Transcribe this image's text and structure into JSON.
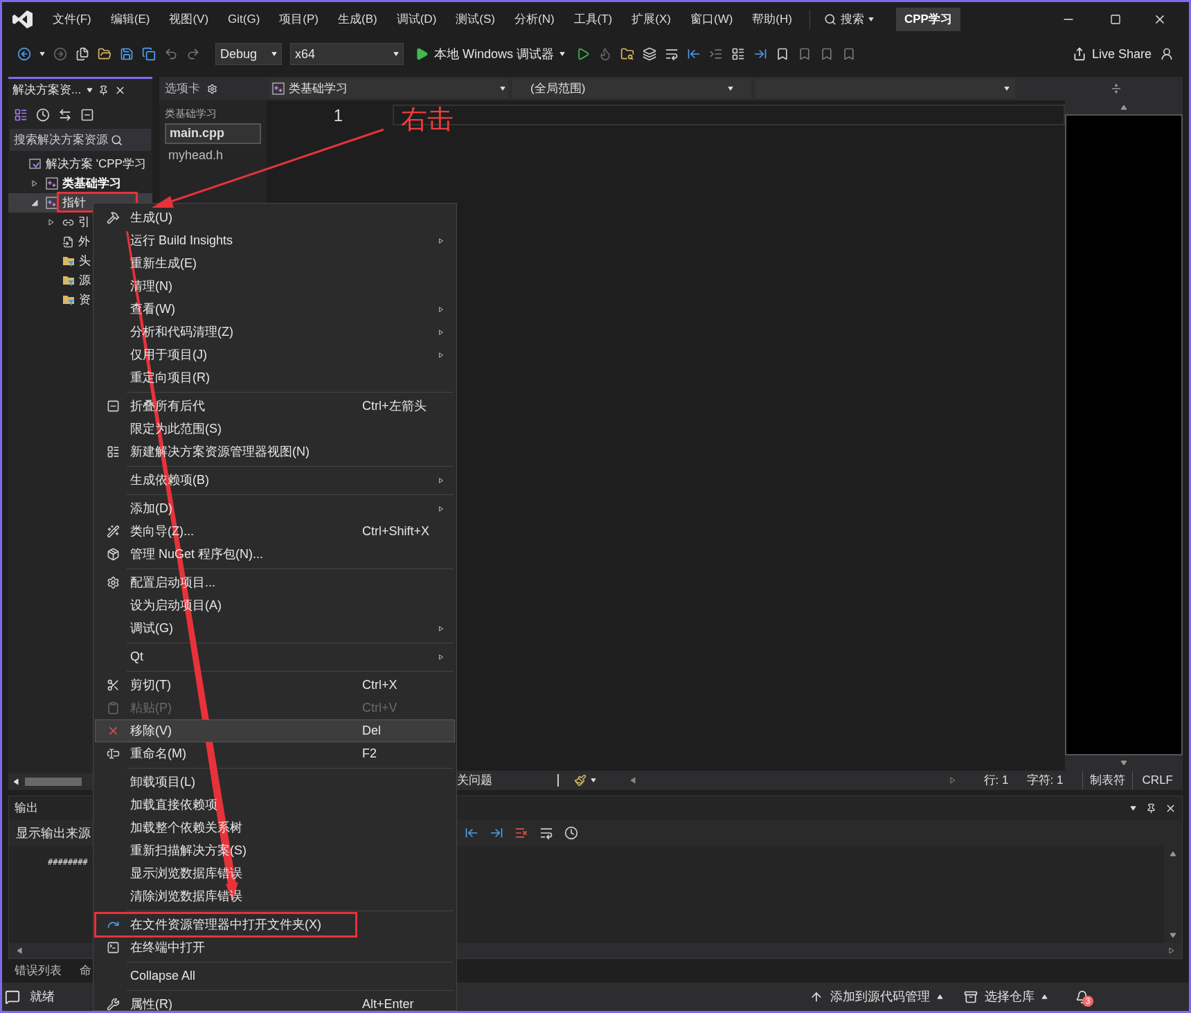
{
  "menubar": {
    "items": [
      "文件(F)",
      "编辑(E)",
      "视图(V)",
      "Git(G)",
      "项目(P)",
      "生成(B)",
      "调试(D)",
      "测试(S)",
      "分析(N)",
      "工具(T)",
      "扩展(X)",
      "窗口(W)",
      "帮助(H)"
    ],
    "search": "搜索",
    "solution_name": "CPP学习"
  },
  "toolbar": {
    "configuration": "Debug",
    "platform": "x64",
    "debugger": "本地 Windows 调试器",
    "live_share": "Live Share"
  },
  "solution_explorer": {
    "title": "解决方案资...",
    "search_placeholder": "搜索解决方案资源",
    "tree": [
      {
        "label": "解决方案 'CPP学习",
        "kind": "solution",
        "children": [
          {
            "label": "类基础学习",
            "kind": "project",
            "startup": true,
            "expanded": false,
            "selected": false,
            "annotated": false
          },
          {
            "label": "指针",
            "kind": "project",
            "startup": false,
            "expanded": true,
            "selected": true,
            "annotated": true,
            "children": [
              {
                "label": "引",
                "kind": "references",
                "expanded": false
              },
              {
                "label": "外",
                "kind": "external"
              },
              {
                "label": "头",
                "kind": "filter"
              },
              {
                "label": "源",
                "kind": "filter"
              },
              {
                "label": "资",
                "kind": "filter"
              }
            ]
          }
        ]
      }
    ]
  },
  "tabs_panel": {
    "title": "选项卡",
    "groups": [
      {
        "name": "类基础学习",
        "files": [
          {
            "label": "main.cpp",
            "selected": true
          },
          {
            "label": "myhead.h",
            "selected": false
          }
        ]
      }
    ]
  },
  "editor": {
    "project": "类基础学习",
    "scope": "(全局范围)",
    "line_numbers": [
      "1"
    ],
    "status": {
      "issues": "关问题",
      "line": "行: 1",
      "column": "字符: 1",
      "indent": "制表符",
      "eol": "CRLF"
    }
  },
  "output": {
    "title": "输出",
    "source_label": "显示输出来源",
    "lines": [
      "########"
    ]
  },
  "bottom_tabs": [
    "错误列表",
    "命"
  ],
  "status_bar": {
    "state": "就绪",
    "source_control": "添加到源代码管理",
    "repository": "选择仓库",
    "notifications": "3"
  },
  "annotation": {
    "callout": "右击"
  },
  "context_menu": {
    "items": [
      {
        "kind": "item",
        "label": "生成(U)",
        "submenu": false,
        "disabled": false,
        "selected": false
      },
      {
        "kind": "item",
        "label": "运行 Build Insights",
        "submenu": true,
        "disabled": false,
        "selected": false
      },
      {
        "kind": "item",
        "label": "重新生成(E)",
        "submenu": false,
        "disabled": false,
        "selected": false
      },
      {
        "kind": "item",
        "label": "清理(N)",
        "submenu": false,
        "disabled": false,
        "selected": false
      },
      {
        "kind": "item",
        "label": "查看(W)",
        "submenu": true,
        "disabled": false,
        "selected": false
      },
      {
        "kind": "item",
        "label": "分析和代码清理(Z)",
        "submenu": true,
        "disabled": false,
        "selected": false
      },
      {
        "kind": "item",
        "label": "仅用于项目(J)",
        "submenu": true,
        "disabled": false,
        "selected": false
      },
      {
        "kind": "item",
        "label": "重定向项目(R)",
        "submenu": false,
        "disabled": false,
        "selected": false
      },
      {
        "kind": "separator"
      },
      {
        "kind": "item",
        "label": "折叠所有后代",
        "shortcut": "Ctrl+左箭头",
        "submenu": false,
        "disabled": false,
        "selected": false
      },
      {
        "kind": "item",
        "label": "限定为此范围(S)",
        "submenu": false,
        "disabled": false,
        "selected": false
      },
      {
        "kind": "item",
        "label": "新建解决方案资源管理器视图(N)",
        "submenu": false,
        "disabled": false,
        "selected": false
      },
      {
        "kind": "separator"
      },
      {
        "kind": "item",
        "label": "生成依赖项(B)",
        "submenu": true,
        "disabled": false,
        "selected": false
      },
      {
        "kind": "separator"
      },
      {
        "kind": "item",
        "label": "添加(D)",
        "submenu": true,
        "disabled": false,
        "selected": false
      },
      {
        "kind": "item",
        "label": "类向导(Z)...",
        "shortcut": "Ctrl+Shift+X",
        "submenu": false,
        "disabled": false,
        "selected": false
      },
      {
        "kind": "item",
        "label": "管理 NuGet 程序包(N)...",
        "submenu": false,
        "disabled": false,
        "selected": false
      },
      {
        "kind": "separator"
      },
      {
        "kind": "item",
        "label": "配置启动项目...",
        "submenu": false,
        "disabled": false,
        "selected": false
      },
      {
        "kind": "item",
        "label": "设为启动项目(A)",
        "submenu": false,
        "disabled": false,
        "selected": false
      },
      {
        "kind": "item",
        "label": "调试(G)",
        "submenu": true,
        "disabled": false,
        "selected": false
      },
      {
        "kind": "separator"
      },
      {
        "kind": "item",
        "label": "Qt",
        "submenu": true,
        "disabled": false,
        "selected": false
      },
      {
        "kind": "separator"
      },
      {
        "kind": "item",
        "label": "剪切(T)",
        "shortcut": "Ctrl+X",
        "submenu": false,
        "disabled": false,
        "selected": false
      },
      {
        "kind": "item",
        "label": "粘贴(P)",
        "shortcut": "Ctrl+V",
        "submenu": false,
        "disabled": true,
        "selected": false
      },
      {
        "kind": "item",
        "label": "移除(V)",
        "shortcut": "Del",
        "submenu": false,
        "disabled": false,
        "selected": true
      },
      {
        "kind": "item",
        "label": "重命名(M)",
        "shortcut": "F2",
        "submenu": false,
        "disabled": false,
        "selected": false
      },
      {
        "kind": "separator"
      },
      {
        "kind": "item",
        "label": "卸载项目(L)",
        "submenu": false,
        "disabled": false,
        "selected": false
      },
      {
        "kind": "item",
        "label": "加载直接依赖项",
        "submenu": false,
        "disabled": false,
        "selected": false
      },
      {
        "kind": "item",
        "label": "加载整个依赖关系树",
        "submenu": false,
        "disabled": false,
        "selected": false
      },
      {
        "kind": "item",
        "label": "重新扫描解决方案(S)",
        "submenu": false,
        "disabled": false,
        "selected": false
      },
      {
        "kind": "item",
        "label": "显示浏览数据库错误",
        "submenu": false,
        "disabled": false,
        "selected": false
      },
      {
        "kind": "item",
        "label": "清除浏览数据库错误",
        "submenu": false,
        "disabled": false,
        "selected": false
      },
      {
        "kind": "separator"
      },
      {
        "kind": "item",
        "label": "在文件资源管理器中打开文件夹(X)",
        "submenu": false,
        "disabled": false,
        "selected": false,
        "annotated": true
      },
      {
        "kind": "item",
        "label": "在终端中打开",
        "submenu": false,
        "disabled": false,
        "selected": false
      },
      {
        "kind": "separator"
      },
      {
        "kind": "item",
        "label": "Collapse All",
        "submenu": false,
        "disabled": false,
        "selected": false
      },
      {
        "kind": "separator"
      },
      {
        "kind": "item",
        "label": "属性(R)",
        "shortcut": "Alt+Enter",
        "submenu": false,
        "disabled": false,
        "selected": false
      }
    ]
  }
}
